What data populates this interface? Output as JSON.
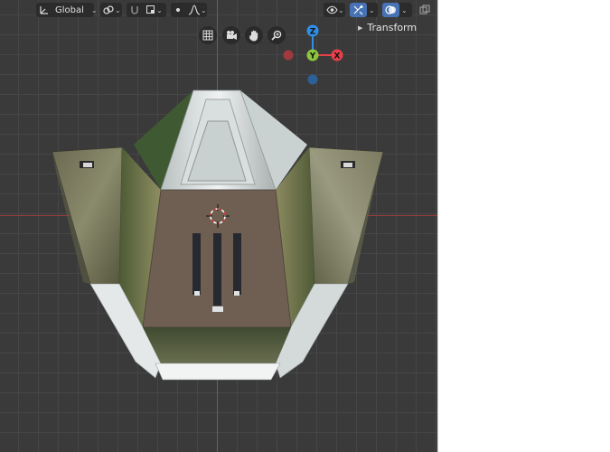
{
  "header": {
    "orientation_label": "Global",
    "orientation_icon": "transform-orientation-icon",
    "pivot_icon": "pivot-point-icon",
    "snap_icon": "snap-magnet-icon",
    "proportional_icon": "proportional-edit-icon",
    "overlay_icon": "overlay-icon",
    "gizmo_toggle_icon": "gizmo-toggle-icon",
    "shading_icon": "viewport-shading-icon"
  },
  "gizmo": {
    "z_label": "Z",
    "y_label": "Y",
    "x_label": "X",
    "colors": {
      "x": "#e6414b",
      "y": "#8cc63f",
      "z": "#2f8fe6",
      "neg_x": "#a03a40",
      "neg_z": "#2d5f99"
    }
  },
  "sidebar": {
    "transform_label": "Transform"
  },
  "colors": {
    "grid_bg": "#3a3a3a",
    "accent": "#4772b3"
  }
}
